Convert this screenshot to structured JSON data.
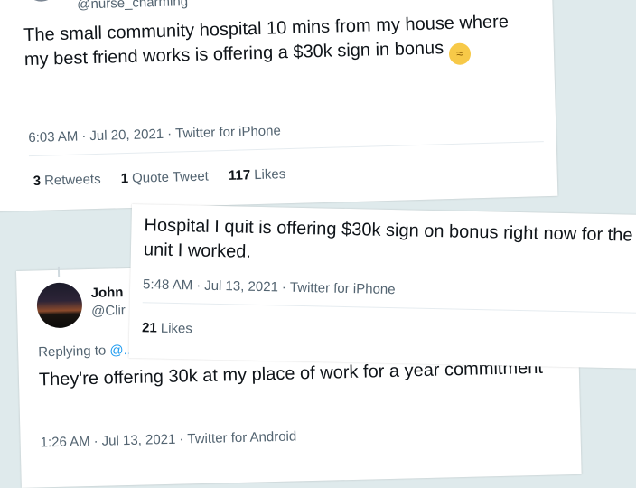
{
  "tweet1": {
    "handle": "@nurse_charming",
    "text": "The small community hospital 10 mins from my house where my best friend works is offering a $30k sign in bonus",
    "emoji": "woozy-face",
    "time": "6:03 AM",
    "date": "Jul 20, 2021",
    "source": "Twitter for iPhone",
    "stats": {
      "retweets_count": "3",
      "retweets_label": "Retweets",
      "quotes_count": "1",
      "quotes_label": "Quote Tweet",
      "likes_count": "117",
      "likes_label": "Likes"
    }
  },
  "tweet2": {
    "text": "Hospital I quit is offering $30k sign on bonus right now for the unit I worked.",
    "time": "5:48 AM",
    "date": "Jul 13, 2021",
    "source": "Twitter for iPhone",
    "stats": {
      "likes_count": "21",
      "likes_label": "Likes"
    }
  },
  "tweet3": {
    "name": "John",
    "handle": "@Clir",
    "replying_label": "Replying to",
    "replying_to": "@...",
    "text": "They're offering 30k at my place of work for a year commitment",
    "time": "1:26 AM",
    "date": "Jul 13, 2021",
    "source": "Twitter for Android"
  },
  "ui": {
    "dot": "·"
  }
}
